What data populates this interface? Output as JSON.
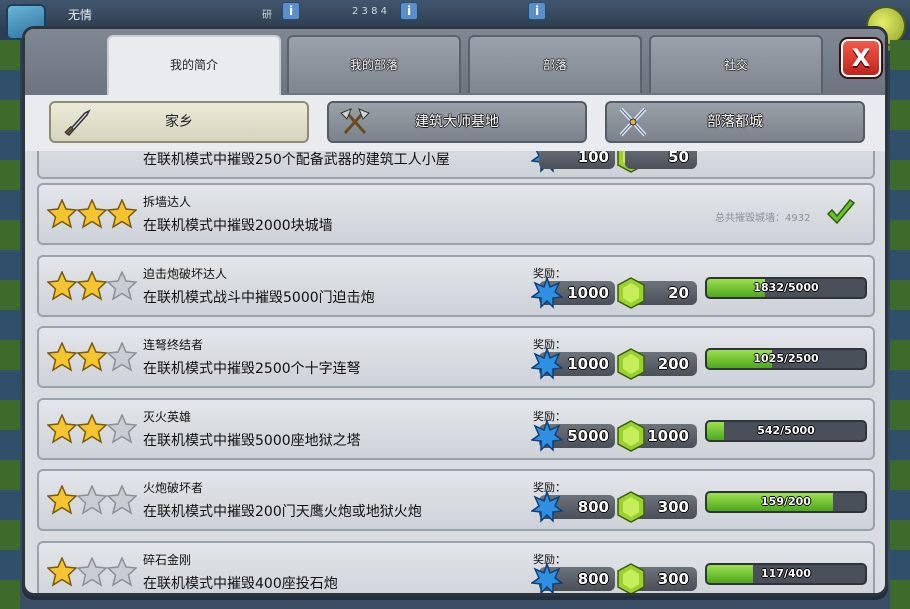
{
  "top": {
    "player_name": "无情",
    "label_a": "研",
    "label_b": "2 3 8 4"
  },
  "tabs": [
    {
      "label": "我的简介",
      "active": true
    },
    {
      "label": "我的部落",
      "active": false
    },
    {
      "label": "部落",
      "active": false
    },
    {
      "label": "社交",
      "active": false
    }
  ],
  "close_label": "X",
  "subtabs": [
    {
      "label": "家乡",
      "icon": "sword-icon",
      "active": true
    },
    {
      "label": "建筑大师基地",
      "icon": "crossed-axes-icon",
      "active": false
    },
    {
      "label": "部落都城",
      "icon": "crossed-swords-icon",
      "active": false
    }
  ],
  "partial_row": {
    "desc": "在联机模式中摧毁250个配备武器的建筑工人小屋",
    "xp": "100",
    "gems": "50"
  },
  "achievements": [
    {
      "title": "拆墙达人",
      "desc": "在联机模式中摧毁2000块城墙",
      "stars": 3,
      "completed": true,
      "total_label": "总共摧毁城墙：4932"
    },
    {
      "title": "迫击炮破坏达人",
      "desc": "在联机模式战斗中摧毁5000门迫击炮",
      "stars": 2,
      "reward_label": "奖励：",
      "xp": "1000",
      "gems": "20",
      "progress_text": "1832/5000",
      "progress": 0.3664
    },
    {
      "title": "连弩终结者",
      "desc": "在联机模式中摧毁2500个十字连弩",
      "stars": 2,
      "reward_label": "奖励：",
      "xp": "1000",
      "gems": "200",
      "progress_text": "1025/2500",
      "progress": 0.41
    },
    {
      "title": "灭火英雄",
      "desc": "在联机模式中摧毁5000座地狱之塔",
      "stars": 2,
      "reward_label": "奖励：",
      "xp": "5000",
      "gems": "1000",
      "progress_text": "542/5000",
      "progress": 0.1084
    },
    {
      "title": "火炮破坏者",
      "desc": "在联机模式中摧毁200门天鹰火炮或地狱火炮",
      "stars": 1,
      "reward_label": "奖励：",
      "xp": "800",
      "gems": "300",
      "progress_text": "159/200",
      "progress": 0.795
    },
    {
      "title": "碎石金刚",
      "desc": "在联机模式中摧毁400座投石炮",
      "stars": 1,
      "reward_label": "奖励：",
      "xp": "800",
      "gems": "300",
      "progress_text": "117/400",
      "progress": 0.2925
    }
  ],
  "colors": {
    "star_gold": "#f4c531",
    "star_empty": "#c9cdd2",
    "xp_blue": "#2f8fe0",
    "gem_green": "#9bd12f",
    "progress_green": "#6cc22c",
    "close_red": "#d7312a"
  }
}
